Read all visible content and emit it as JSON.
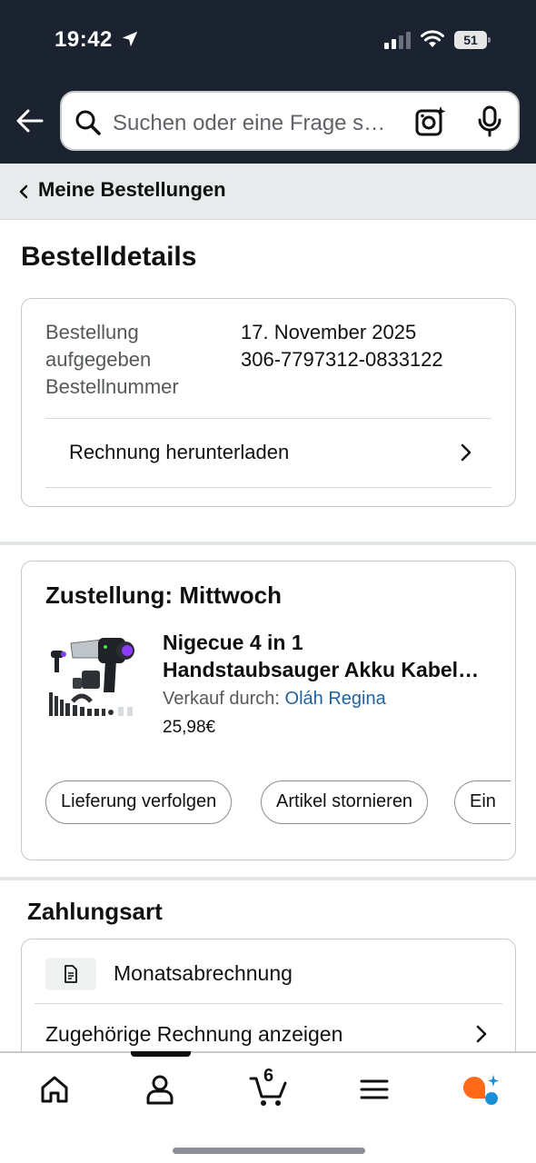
{
  "status_bar": {
    "time": "19:42",
    "battery": "51"
  },
  "search": {
    "placeholder": "Suchen oder eine Frage s…"
  },
  "breadcrumb": {
    "label": "Meine Bestellungen"
  },
  "page_title": "Bestelldetails",
  "order_info": {
    "placed_label_1": "Bestellung",
    "placed_label_2": "aufgegeben",
    "number_label": "Bestellnummer",
    "placed_value": "17. November 2025",
    "number_value": "306-7797312-0833122",
    "invoice_link": "Rechnung herunterladen"
  },
  "delivery": {
    "heading": "Zustellung: Mittwoch",
    "product_title_line1": "Nigecue 4 in 1",
    "product_title_line2": "Handstaubsauger Akku Kabel…",
    "seller_prefix": "Verkauf durch: ",
    "seller_name": "Oláh Regina",
    "price": "25,98€",
    "actions": [
      "Lieferung verfolgen",
      "Artikel stornieren",
      "Ein"
    ]
  },
  "payment": {
    "heading": "Zahlungsart",
    "method": "Monatsabrechnung",
    "invoice_link": "Zugehörige Rechnung anzeigen"
  },
  "bottom_nav": {
    "cart_count": "6",
    "items": [
      "home-icon",
      "account-icon",
      "cart-icon",
      "menu-icon",
      "assistant-icon"
    ]
  },
  "colors": {
    "header_bg": "#1b2230",
    "link_blue": "#2162a1",
    "crumb_bg": "#e8eaeb"
  }
}
